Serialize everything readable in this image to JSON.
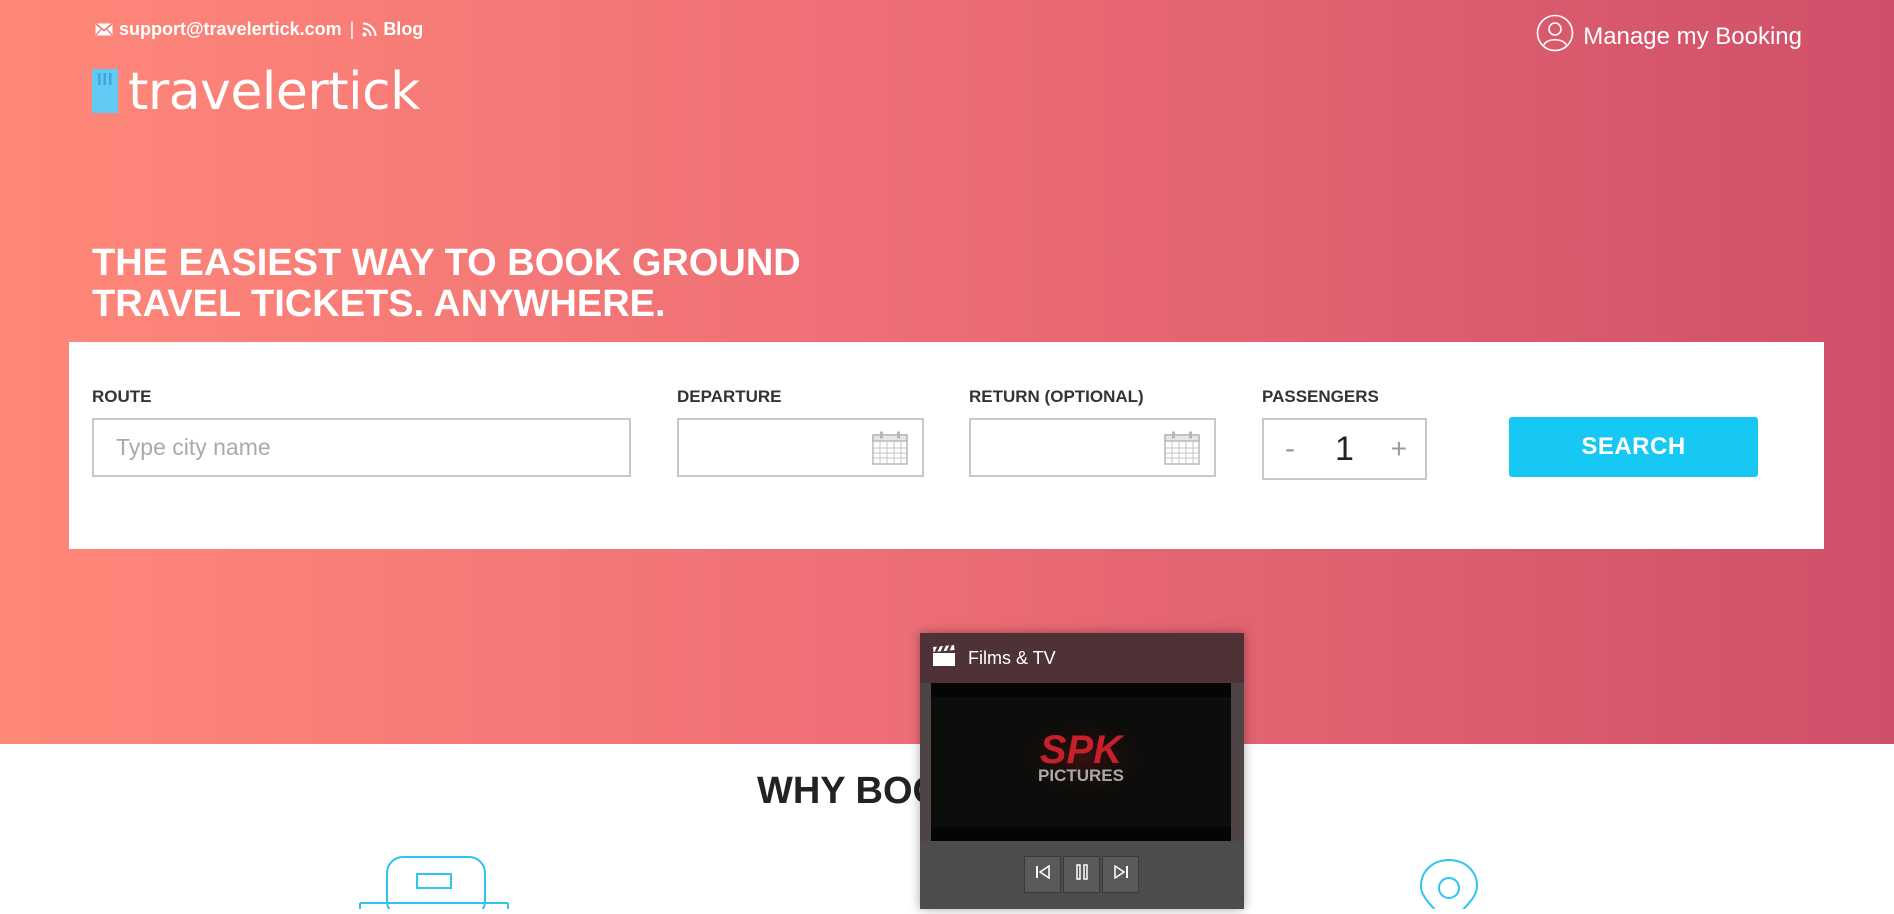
{
  "header": {
    "support_email": "support@travelertick.com",
    "separator": "|",
    "blog_label": "Blog",
    "manage_booking_label": "Manage my Booking"
  },
  "logo": {
    "wordmark": "travelertick"
  },
  "hero": {
    "headline_line1": "THE EASIEST WAY TO BOOK GROUND",
    "headline_line2": "TRAVEL TICKETS. ANYWHERE."
  },
  "search": {
    "route_label": "ROUTE",
    "route_placeholder": "Type city name",
    "route_value": "",
    "departure_label": "DEPARTURE",
    "departure_value": "",
    "return_label": "RETURN (OPTIONAL)",
    "return_value": "",
    "passengers_label": "PASSENGERS",
    "passengers_decrement": "-",
    "passengers_value": "1",
    "passengers_increment": "+",
    "search_button_label": "SEARCH"
  },
  "section": {
    "why_heading_partial": "WHY BOO"
  },
  "films_window": {
    "title": "Films & TV",
    "video_frame_logo": "SPK",
    "video_frame_sub": "PICTURES"
  },
  "icons": {
    "mail": "mail-icon",
    "rss": "rss-icon",
    "user": "user-circle-icon",
    "calendar": "calendar-icon",
    "bus": "bus-icon",
    "location": "location-pin-icon",
    "clapperboard": "clapperboard-icon",
    "previous": "previous-track-icon",
    "pause": "pause-icon",
    "next": "next-track-icon"
  },
  "colors": {
    "gradient_start": "#ff8878",
    "gradient_end": "#cf5069",
    "accent_cyan": "#17c8f5",
    "logo_cyan": "#62c8f4"
  }
}
